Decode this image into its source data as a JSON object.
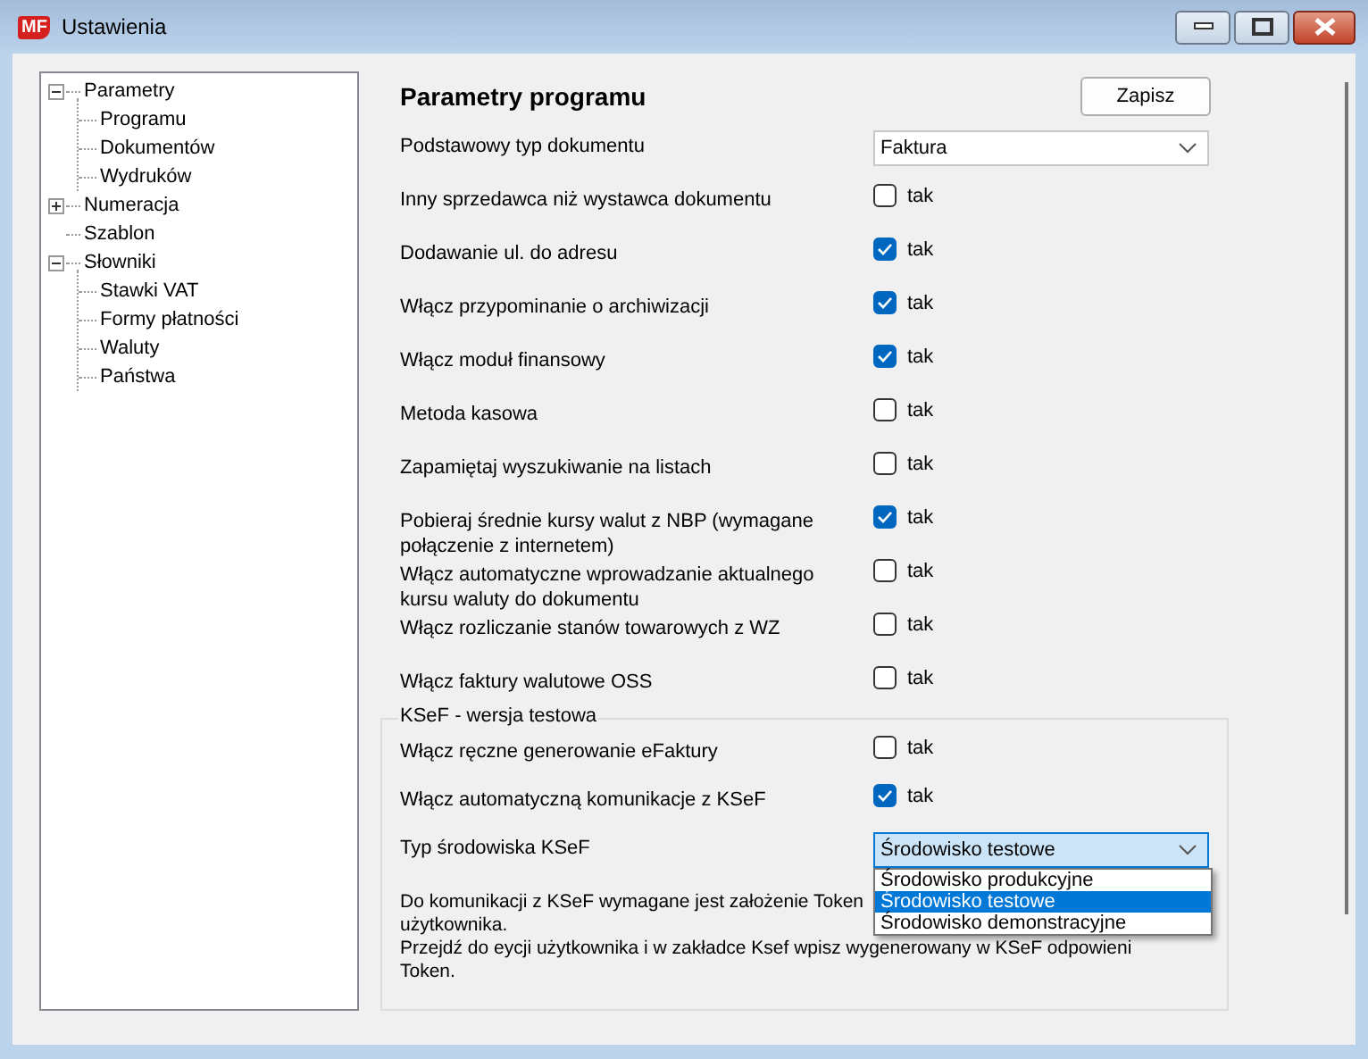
{
  "window": {
    "logo": "MF",
    "title": "Ustawienia"
  },
  "tree": [
    {
      "label": "Parametry",
      "expanded": true,
      "children": [
        {
          "label": "Programu"
        },
        {
          "label": "Dokumentów"
        },
        {
          "label": "Wydruków"
        }
      ]
    },
    {
      "label": "Numeracja",
      "expanded": false
    },
    {
      "label": "Szablon"
    },
    {
      "label": "Słowniki",
      "expanded": true,
      "children": [
        {
          "label": "Stawki VAT"
        },
        {
          "label": "Formy płatności"
        },
        {
          "label": "Waluty"
        },
        {
          "label": "Państwa"
        }
      ]
    }
  ],
  "heading": "Parametry programu",
  "save_button": "Zapisz",
  "settings": [
    {
      "kind": "select",
      "label": "Podstawowy  typ dokumentu",
      "value": "Faktura"
    },
    {
      "kind": "checkbox",
      "label": "Inny sprzedawca niż wystawca dokumentu",
      "checked": false,
      "caption": "tak"
    },
    {
      "kind": "checkbox",
      "label": "Dodawanie ul. do adresu",
      "checked": true,
      "caption": "tak"
    },
    {
      "kind": "checkbox",
      "label": "Włącz przypominanie o archiwizacji",
      "checked": true,
      "caption": "tak"
    },
    {
      "kind": "checkbox",
      "label": "Włącz moduł finansowy",
      "checked": true,
      "caption": "tak"
    },
    {
      "kind": "checkbox",
      "label": "Metoda kasowa",
      "checked": false,
      "caption": "tak"
    },
    {
      "kind": "checkbox",
      "label": "Zapamiętaj wyszukiwanie na listach",
      "checked": false,
      "caption": "tak"
    },
    {
      "kind": "checkbox",
      "label": "Pobieraj średnie kursy walut z NBP  (wymagane połączenie z internetem)",
      "checked": true,
      "caption": "tak"
    },
    {
      "kind": "checkbox",
      "label": "Włącz automatyczne wprowadzanie aktualnego kursu waluty do dokumentu",
      "checked": false,
      "caption": "tak"
    },
    {
      "kind": "checkbox",
      "label": "Włącz rozliczanie stanów towarowych z WZ",
      "checked": false,
      "caption": "tak"
    },
    {
      "kind": "checkbox",
      "label": "Włącz faktury walutowe OSS",
      "checked": false,
      "caption": "tak"
    }
  ],
  "ksef": {
    "title": "KSeF - wersja testowa",
    "settings": [
      {
        "kind": "checkbox",
        "label": "Włącz ręczne generowanie eFaktury",
        "checked": false,
        "caption": "tak"
      },
      {
        "kind": "checkbox",
        "label": "Włącz automatyczną komunikacje z KSeF",
        "checked": true,
        "caption": "tak"
      }
    ],
    "environment": {
      "label": "Typ środowiska KSeF",
      "value": "Środowisko testowe",
      "open": true,
      "options": [
        {
          "label": "Środowisko produkcyjne",
          "selected": false
        },
        {
          "label": "Środowisko testowe",
          "selected": true
        },
        {
          "label": "Środowisko demonstracyjne",
          "selected": false
        }
      ]
    },
    "note_lines": [
      "Do komunikacji z KSeF wymagane jest założenie Token",
      "użytkownika.",
      "Przejdź do eycji użytkownika i w zakładce Ksef wpisz wygenerowany w KSeF odpowieni",
      "Token."
    ]
  }
}
